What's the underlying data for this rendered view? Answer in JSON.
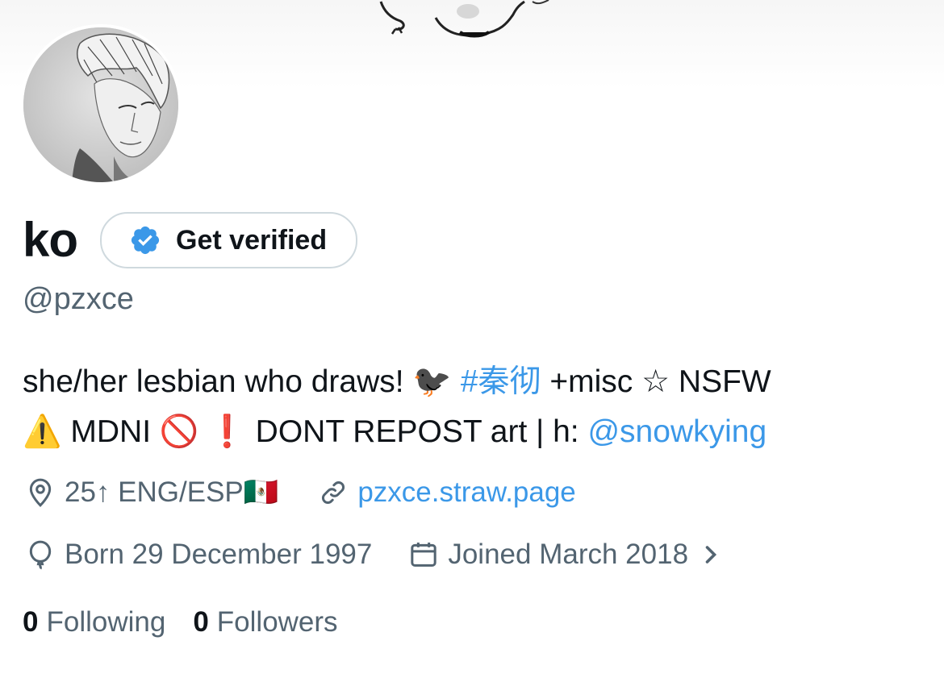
{
  "profile": {
    "display_name": "ko",
    "handle": "@pzxce",
    "get_verified_label": "Get verified"
  },
  "bio": {
    "part1": "she/her lesbian who draws! 🐦‍⬛ ",
    "hashtag": "#秦彻",
    "part2": " +misc ☆ NSFW",
    "part3": "⚠️ MDNI 🚫 ❗ DONT REPOST art | h: ",
    "mention": "@snowkying"
  },
  "meta": {
    "location": "25↑ ENG/ESP🇲🇽",
    "website": "pzxce.straw.page",
    "birthday": "Born 29 December 1997",
    "joined": "Joined March 2018",
    "icons": [
      "location-pin-icon",
      "link-icon",
      "balloon-icon",
      "calendar-icon",
      "chevron-right-icon"
    ]
  },
  "stats": {
    "following_count": "0",
    "following_label": "Following",
    "followers_count": "0",
    "followers_label": "Followers"
  },
  "colors": {
    "link": "#3b98e8",
    "verified_badge": "#3b98e8",
    "secondary_text": "#536471",
    "primary_text": "#0f1419"
  }
}
